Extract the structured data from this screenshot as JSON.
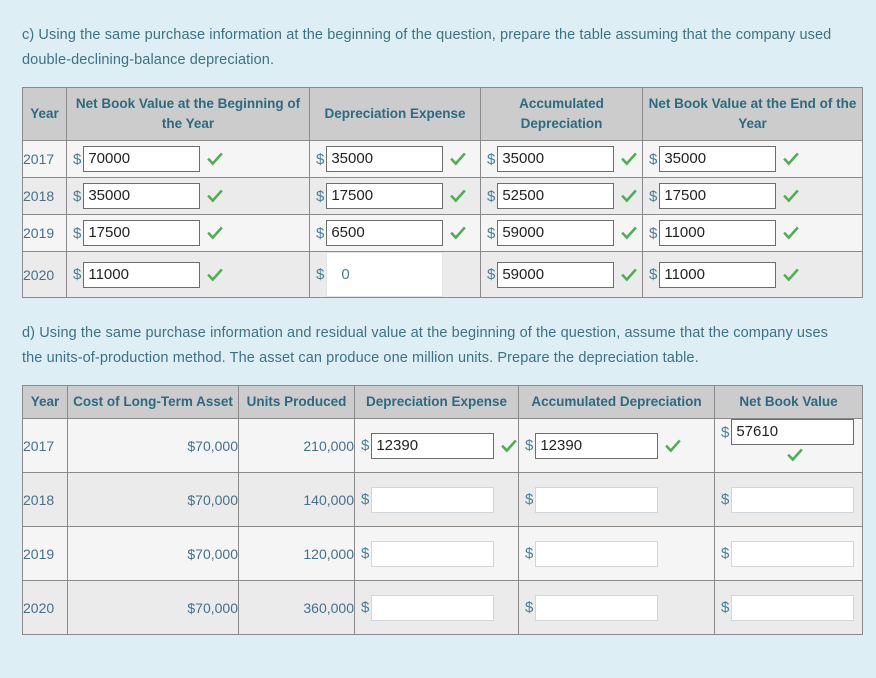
{
  "prompts": {
    "c": "c) Using the same purchase information at the beginning of the question, prepare the table assuming that the company used double-declining-balance depreciation.",
    "d": "d) Using the same purchase information and residual value at the beginning of the question, assume that the company uses the units-of-production method. The asset can produce one million units. Prepare the depreciation table."
  },
  "colors": {
    "page_background": "#ddeef4",
    "header_background": "#cccccc",
    "header_text": "#2c6a80",
    "body_text": "#4a7f96",
    "check_green": "#4caf50",
    "border": "#8a8a8a",
    "row_alt_a": "#f5f5f5",
    "row_alt_b": "#ebebeb"
  },
  "table1": {
    "headers": {
      "year": "Year",
      "nbv_begin": "Net Book Value at the Beginning of the Year",
      "dep_expense": "Depreciation Expense",
      "acc_dep": "Accumulated Depreciation",
      "nbv_end": "Net Book Value at the End of the Year"
    },
    "currency_symbol": "$",
    "rows": [
      {
        "year": "2017",
        "nbv_begin": {
          "value": "70000",
          "checked": true,
          "state": "filled"
        },
        "dep_expense": {
          "value": "35000",
          "checked": true,
          "state": "filled"
        },
        "acc_dep": {
          "value": "35000",
          "checked": true,
          "state": "filled"
        },
        "nbv_end": {
          "value": "35000",
          "checked": true,
          "state": "filled"
        }
      },
      {
        "year": "2018",
        "nbv_begin": {
          "value": "35000",
          "checked": true,
          "state": "filled"
        },
        "dep_expense": {
          "value": "17500",
          "checked": true,
          "state": "filled"
        },
        "acc_dep": {
          "value": "52500",
          "checked": true,
          "state": "filled"
        },
        "nbv_end": {
          "value": "17500",
          "checked": true,
          "state": "filled"
        }
      },
      {
        "year": "2019",
        "nbv_begin": {
          "value": "17500",
          "checked": true,
          "state": "filled"
        },
        "dep_expense": {
          "value": "6500",
          "checked": true,
          "state": "filled"
        },
        "acc_dep": {
          "value": "59000",
          "checked": true,
          "state": "filled"
        },
        "nbv_end": {
          "value": "11000",
          "checked": true,
          "state": "filled"
        }
      },
      {
        "year": "2020",
        "nbv_begin": {
          "value": "11000",
          "checked": true,
          "state": "filled"
        },
        "dep_expense": {
          "value": "0",
          "checked": false,
          "state": "focused"
        },
        "acc_dep": {
          "value": "59000",
          "checked": true,
          "state": "filled"
        },
        "nbv_end": {
          "value": "11000",
          "checked": true,
          "state": "filled"
        }
      }
    ]
  },
  "table2": {
    "headers": {
      "year": "Year",
      "cost": "Cost of Long-Term Asset",
      "units": "Units Produced",
      "dep_expense": "Depreciation Expense",
      "acc_dep": "Accumulated Depreciation",
      "nbv": "Net Book Value"
    },
    "currency_symbol": "$",
    "rows": [
      {
        "year": "2017",
        "cost": "$70,000",
        "units": "210,000",
        "dep_expense": {
          "value": "12390",
          "checked": true,
          "state": "filled"
        },
        "acc_dep": {
          "value": "12390",
          "checked": true,
          "state": "filled"
        },
        "nbv": {
          "value": "57610",
          "checked": true,
          "state": "filled-stacked"
        }
      },
      {
        "year": "2018",
        "cost": "$70,000",
        "units": "140,000",
        "dep_expense": {
          "value": "",
          "checked": false,
          "state": "empty"
        },
        "acc_dep": {
          "value": "",
          "checked": false,
          "state": "empty"
        },
        "nbv": {
          "value": "",
          "checked": false,
          "state": "empty"
        }
      },
      {
        "year": "2019",
        "cost": "$70,000",
        "units": "120,000",
        "dep_expense": {
          "value": "",
          "checked": false,
          "state": "empty"
        },
        "acc_dep": {
          "value": "",
          "checked": false,
          "state": "empty"
        },
        "nbv": {
          "value": "",
          "checked": false,
          "state": "empty"
        }
      },
      {
        "year": "2020",
        "cost": "$70,000",
        "units": "360,000",
        "dep_expense": {
          "value": "",
          "checked": false,
          "state": "empty"
        },
        "acc_dep": {
          "value": "",
          "checked": false,
          "state": "empty"
        },
        "nbv": {
          "value": "",
          "checked": false,
          "state": "empty"
        }
      }
    ]
  },
  "icons": {
    "check": "check-icon"
  }
}
